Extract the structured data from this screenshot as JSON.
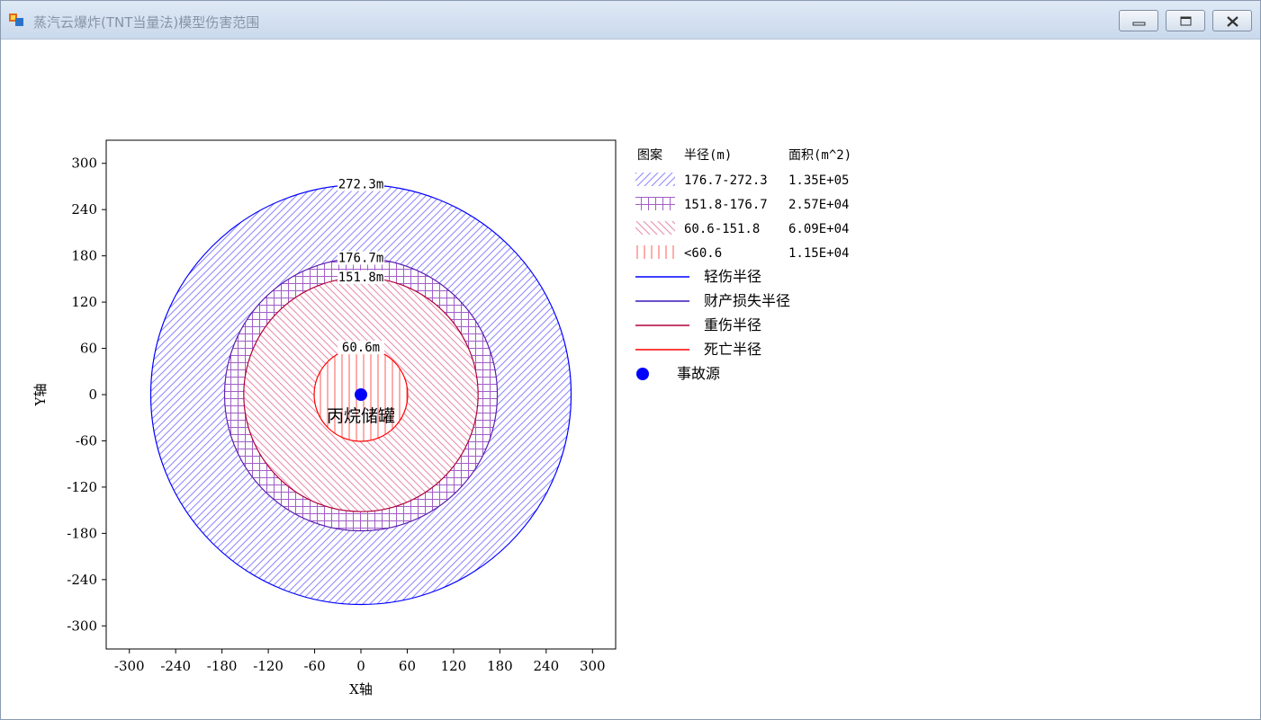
{
  "window": {
    "title": "蒸汽云爆炸(TNT当量法)模型伤害范围",
    "controls": [
      "minimize",
      "restore",
      "close"
    ]
  },
  "chart_data": {
    "type": "area",
    "xlabel": "X轴",
    "ylabel": "Y轴",
    "xlim": [
      -330,
      330
    ],
    "ylim": [
      -330,
      330
    ],
    "ticks": [
      -300,
      -240,
      -180,
      -120,
      -60,
      0,
      60,
      120,
      180,
      240,
      300
    ],
    "tick_labels": [
      "-300",
      "-240",
      "-180",
      "-120",
      "-60",
      "0",
      "60",
      "120",
      "180",
      "240",
      "300"
    ],
    "source": {
      "x": 0,
      "y": 0,
      "label": "丙烷储罐",
      "color": "#0000ff"
    },
    "circles": [
      {
        "radius": 272.3,
        "label": "272.3m",
        "color": "#0000ff",
        "hatch": "diag-right",
        "hatch_color": "#8b85ff"
      },
      {
        "radius": 176.7,
        "label": "176.7m",
        "color": "#5a1fb0",
        "hatch": "grid",
        "hatch_color": "#a15ec7"
      },
      {
        "radius": 151.8,
        "label": "151.8m",
        "color": "#b0003a",
        "hatch": "diag-left",
        "hatch_color": "#e88aa8"
      },
      {
        "radius": 60.6,
        "label": "60.6m",
        "color": "#ff0000",
        "hatch": "vertical",
        "hatch_color": "#ff5a5a"
      }
    ],
    "legend": {
      "headers": [
        "图案",
        "半径(m)",
        "面积(m^2)"
      ],
      "rows": [
        {
          "pattern": "diag-right",
          "range": "176.7-272.3",
          "area": "1.35E+05",
          "color": "#8b85ff"
        },
        {
          "pattern": "grid",
          "range": "151.8-176.7",
          "area": "2.57E+04",
          "color": "#a15ec7"
        },
        {
          "pattern": "diag-left",
          "range": "60.6-151.8",
          "area": "6.09E+04",
          "color": "#e88aa8"
        },
        {
          "pattern": "vertical",
          "range": "<60.6",
          "area": "1.15E+04",
          "color": "#ff5a5a"
        }
      ],
      "lines": [
        {
          "label": "轻伤半径",
          "color": "#0000ff"
        },
        {
          "label": "财产损失半径",
          "color": "#3a17b8"
        },
        {
          "label": "重伤半径",
          "color": "#b0003a"
        },
        {
          "label": "死亡半径",
          "color": "#ff0000"
        }
      ],
      "point": {
        "label": "事故源",
        "color": "#0000ff"
      }
    }
  }
}
